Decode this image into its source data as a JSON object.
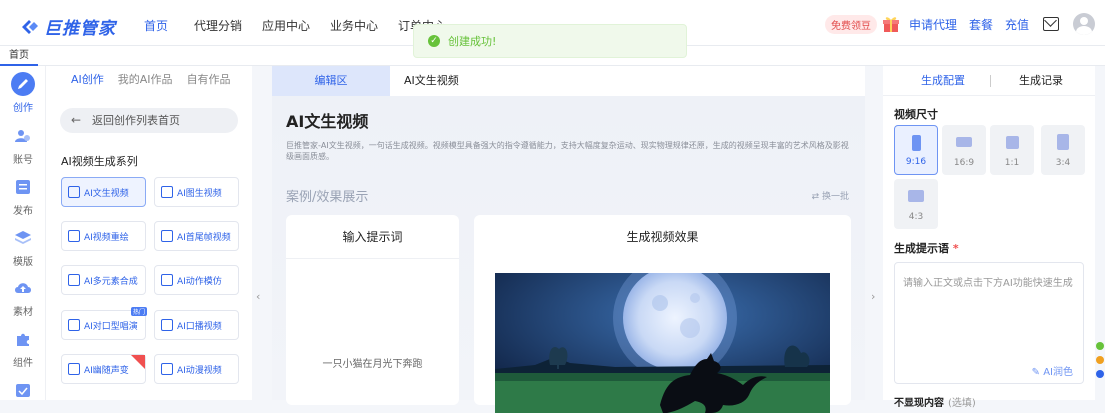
{
  "header": {
    "logo_text": "巨推管家",
    "nav": [
      "首页",
      "代理分销",
      "应用中心",
      "业务中心",
      "订单中心"
    ],
    "free_badge": "免费领豆",
    "apply_agent": "申请代理",
    "packages": "套餐",
    "recharge": "充值"
  },
  "toast": {
    "text": "创建成功!"
  },
  "tabs": {
    "home": "首页"
  },
  "sidebar": {
    "items": [
      {
        "label": "创作",
        "icon": "pen-icon"
      },
      {
        "label": "账号",
        "icon": "users-icon"
      },
      {
        "label": "发布",
        "icon": "publish-icon"
      },
      {
        "label": "模版",
        "icon": "layers-icon"
      },
      {
        "label": "素材",
        "icon": "cloud-icon"
      },
      {
        "label": "组件",
        "icon": "puzzle-icon"
      }
    ]
  },
  "left_panel": {
    "tabs": [
      "AI创作",
      "我的AI作品",
      "自有作品"
    ],
    "back": "返回创作列表首页",
    "series_title": "AI视频生成系列",
    "functions": [
      {
        "label": "AI文生视频"
      },
      {
        "label": "AI图生视频"
      },
      {
        "label": "AI视频重绘"
      },
      {
        "label": "AI首尾帧视频"
      },
      {
        "label": "AI多元素合成"
      },
      {
        "label": "AI动作模仿"
      },
      {
        "label": "AI对口型唱演",
        "tag": "热门"
      },
      {
        "label": "AI口播视频"
      },
      {
        "label": "AI幽随声变"
      },
      {
        "label": "AI动漫视频"
      }
    ]
  },
  "main": {
    "edit_tab": "编辑区",
    "tab_title": "AI文生视频",
    "heading": "AI文生视频",
    "description": "巨推管家-AI文生视频，一句话生成视频。视频模型具备强大的指令遵循能力，支持大幅度复杂运动、现实物理规律还原，生成的视频呈现丰富的艺术风格及影视级画面质感。",
    "case_title": "案例/效果展示",
    "swap": "换一批",
    "prompt_card_title": "输入提示词",
    "prompt_example": "一只小猫在月光下奔跑",
    "result_card_title": "生成视频效果"
  },
  "right_panel": {
    "tab_config": "生成配置",
    "tab_records": "生成记录",
    "size_label": "视频尺寸",
    "sizes": [
      "9:16",
      "16:9",
      "1:1",
      "3:4",
      "4:3"
    ],
    "selected_size": "9:16",
    "prompt_label": "生成提示语",
    "required_mark": "*",
    "prompt_placeholder": "请输入正文或点击下方AI功能快速生成",
    "polish": "AI润色",
    "more_label": "不显现内容",
    "more_sub": "(选填)"
  },
  "colors": {
    "accent": "#2f63e8",
    "success": "#67c23a",
    "panel_bg": "#eef1f7"
  }
}
